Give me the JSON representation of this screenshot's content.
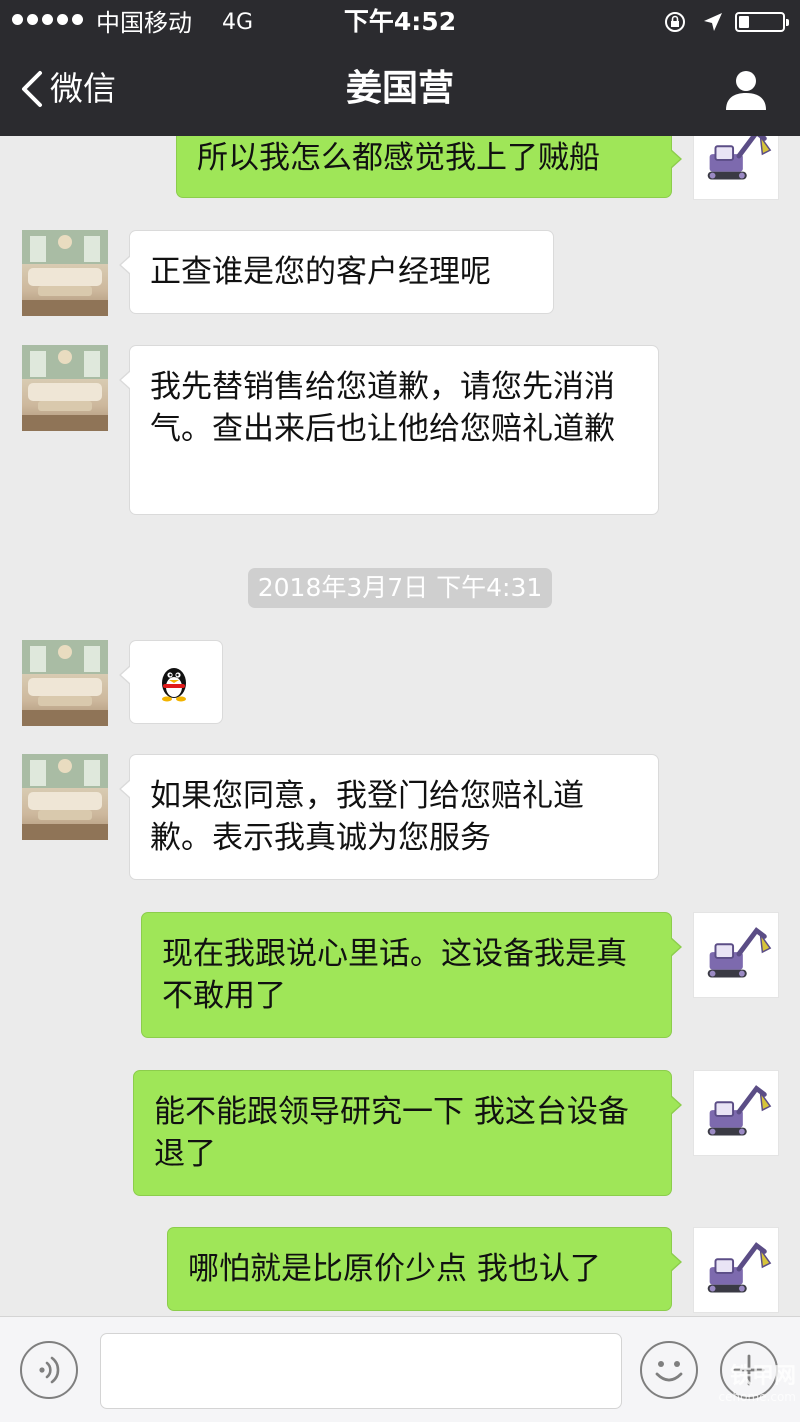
{
  "status_bar": {
    "carrier": "中国移动",
    "network": "4G",
    "time": "下午4:52"
  },
  "nav": {
    "back_label": "微信",
    "title": "姜国营"
  },
  "messages": [
    {
      "side": "right",
      "text": "所以我怎么都感觉我上了贼船"
    },
    {
      "side": "left",
      "text": "正查谁是您的客户经理呢"
    },
    {
      "side": "left",
      "text": "我先替销售给您道歉，请您先消消气。查出来后也让他给您赔礼道歉"
    },
    {
      "side": "left",
      "emoji": "qq-penguin"
    },
    {
      "side": "left",
      "text": "如果您同意，我登门给您赔礼道歉。表示我真诚为您服务"
    },
    {
      "side": "right",
      "text": "现在我跟说心里话。这设备我是真不敢用了"
    },
    {
      "side": "right",
      "text": "能不能跟领导研究一下 我这台设备退了"
    },
    {
      "side": "right",
      "text": "哪怕就是比原价少点 我也认了"
    }
  ],
  "timestamp": "2018年3月7日 下午4:31",
  "input_bar": {
    "text_value": ""
  },
  "watermark": {
    "main": "铁甲网",
    "sub": "cehome.com"
  },
  "colors": {
    "header_bg": "#2b2b2f",
    "chat_bg": "#ebebeb",
    "bubble_self": "#9fe658",
    "bubble_other": "#ffffff",
    "timestamp_bg": "#cfcfcf"
  }
}
